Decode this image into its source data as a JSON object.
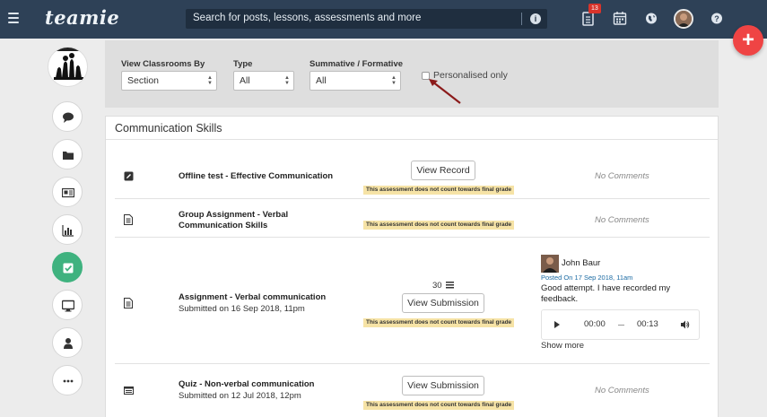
{
  "topbar": {
    "logo": "teamie",
    "search_placeholder": "Search for posts, lessons, assessments and more",
    "notification_count": "13",
    "icons": [
      "menu-icon",
      "info-icon",
      "document-icon",
      "calendar-icon",
      "globe-icon",
      "help-icon"
    ]
  },
  "fab": {
    "label": "+"
  },
  "rail": {
    "items": [
      "chat-icon",
      "folder-icon",
      "newspaper-icon",
      "bar-chart-icon",
      "checkbox-icon",
      "monitor-icon",
      "user-icon",
      "more-icon"
    ],
    "active": "checkbox-icon",
    "active_color": "#3fb27f"
  },
  "filters": {
    "view_by": {
      "label": "View Classrooms By",
      "value": "Section"
    },
    "type": {
      "label": "Type",
      "value": "All"
    },
    "summative": {
      "label": "Summative / Formative",
      "value": "All"
    },
    "personalised": {
      "label": "Personalised only",
      "checked": false
    }
  },
  "card": {
    "title": "Communication Skills",
    "rows": [
      {
        "icon": "edit-square-icon",
        "title": "Offline test - Effective Communication",
        "subtitle": "",
        "button": "View Record",
        "note": "This assessment does not count towards final grade",
        "comments": "No Comments"
      },
      {
        "icon": "document-icon",
        "title_line1": "Group Assignment - Verbal",
        "title_line2": "Communication Skills",
        "note": "This assessment does not count towards final grade",
        "comments": "No Comments"
      },
      {
        "icon": "document-icon",
        "title": "Assignment - Verbal communication",
        "subtitle": "Submitted on 16 Sep 2018, 11pm",
        "score": "30",
        "button": "View Submission",
        "note": "This assessment does not count towards final grade",
        "comment": {
          "author": "John Baur",
          "date": "Posted On 17 Sep 2018, 11am",
          "text": "Good attempt. I have recorded my feedback.",
          "audio_current": "00:00",
          "audio_total": "00:13",
          "show_more": "Show more"
        }
      },
      {
        "icon": "quiz-icon",
        "title": "Quiz - Non-verbal communication",
        "subtitle": "Submitted on 12 Jul 2018, 12pm",
        "button": "View Submission",
        "note": "This assessment does not count towards final grade",
        "comments": "No Comments"
      }
    ]
  },
  "colors": {
    "topbar": "#2e4157",
    "fab": "#ef4444",
    "note_bg": "#f6e3a6",
    "comment_date": "#1b6aa3",
    "arrow": "#8b1a1a"
  }
}
